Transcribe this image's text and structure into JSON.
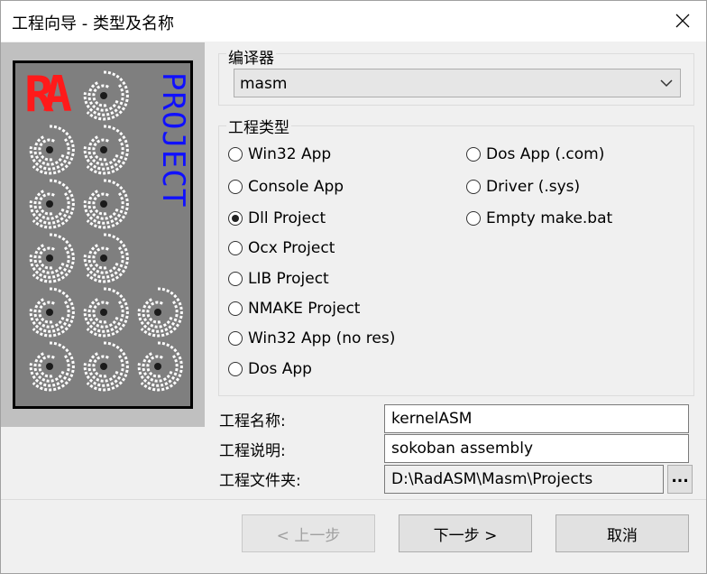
{
  "window": {
    "title": "工程向导 - 类型及名称"
  },
  "banner": {
    "logo_text": "RA",
    "vertical_text": "PROJECT"
  },
  "compiler": {
    "group_label": "编译器",
    "selected": "masm"
  },
  "project_type": {
    "group_label": "工程类型",
    "options": [
      {
        "label": "Win32 App",
        "checked": false
      },
      {
        "label": "Console App",
        "checked": false
      },
      {
        "label": "Dll Project",
        "checked": true
      },
      {
        "label": "Ocx Project",
        "checked": false
      },
      {
        "label": "LIB Project",
        "checked": false
      },
      {
        "label": "NMAKE Project",
        "checked": false
      },
      {
        "label": "Win32 App (no res)",
        "checked": false
      },
      {
        "label": "Dos App",
        "checked": false
      },
      {
        "label": "Dos App (.com)",
        "checked": false
      },
      {
        "label": "Driver (.sys)",
        "checked": false
      },
      {
        "label": "Empty make.bat",
        "checked": false
      }
    ]
  },
  "fields": {
    "name_label": "工程名称:",
    "name_value": "kernelASM",
    "desc_label": "工程说明:",
    "desc_value": "sokoban assembly",
    "folder_label": "工程文件夹:",
    "folder_value": "D:\\RadASM\\Masm\\Projects",
    "browse_label": "..."
  },
  "buttons": {
    "back": "< 上一步",
    "next": "下一步 >",
    "cancel": "取消"
  }
}
